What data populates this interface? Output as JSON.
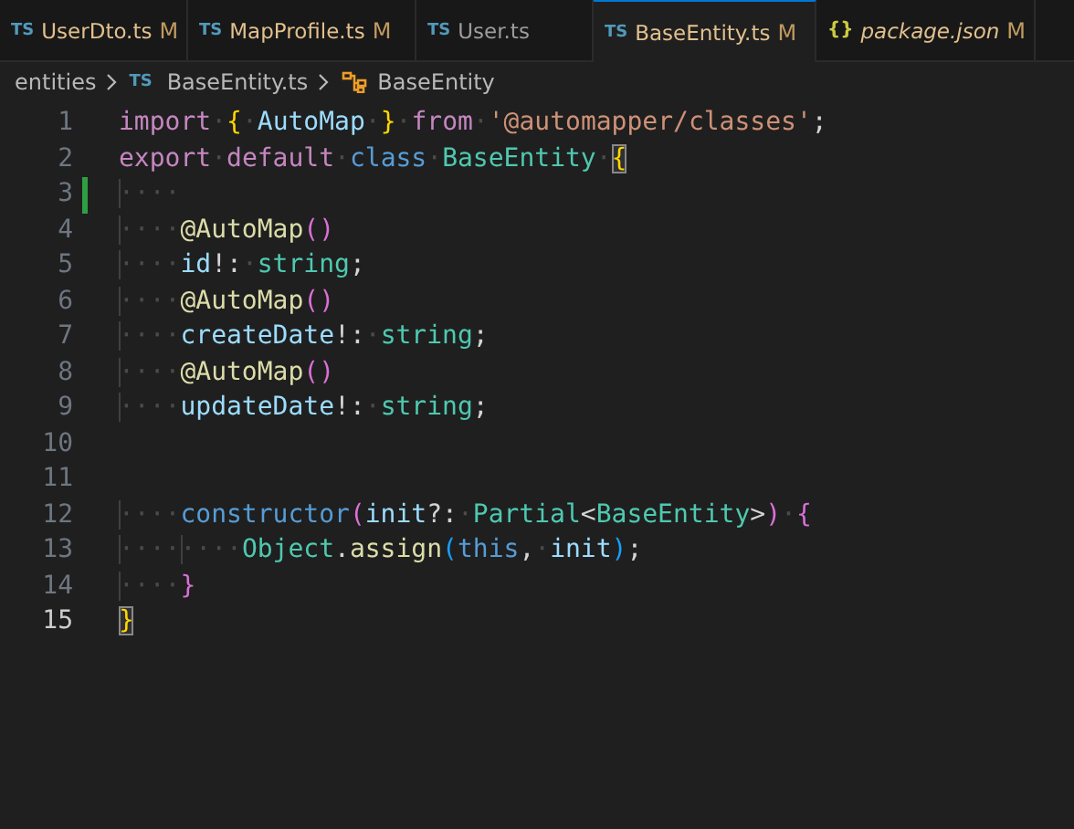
{
  "tabs": [
    {
      "kind": "ts",
      "icon_text": "TS",
      "label": "UserDto.ts",
      "status": "M",
      "selected": false,
      "preview": false
    },
    {
      "kind": "ts",
      "icon_text": "TS",
      "label": "MapProfile.ts",
      "status": "M",
      "selected": false,
      "preview": false
    },
    {
      "kind": "ts",
      "icon_text": "TS",
      "label": "User.ts",
      "selected": false,
      "preview": false
    },
    {
      "kind": "ts",
      "icon_text": "TS",
      "label": "BaseEntity.ts",
      "status": "M",
      "selected": true,
      "preview": false
    },
    {
      "kind": "json",
      "icon_text": "{}",
      "label": "package.json",
      "status": "M",
      "selected": false,
      "preview": true
    }
  ],
  "breadcrumb": [
    {
      "kind": "folder",
      "label": "entities"
    },
    {
      "kind": "file",
      "icon_text": "TS",
      "label": "BaseEntity.ts"
    },
    {
      "kind": "class",
      "label": "BaseEntity"
    }
  ],
  "lines": [
    {
      "number": "1",
      "tokens": [
        {
          "kind": "kw",
          "text": "import"
        },
        {
          "kind": "ws",
          "text": "·"
        },
        {
          "kind": "brace",
          "text": "{"
        },
        {
          "kind": "ws",
          "text": "·"
        },
        {
          "kind": "ident",
          "text": "AutoMap"
        },
        {
          "kind": "ws",
          "text": "·"
        },
        {
          "kind": "brace",
          "text": "}"
        },
        {
          "kind": "ws",
          "text": "·"
        },
        {
          "kind": "kw",
          "text": "from"
        },
        {
          "kind": "ws",
          "text": "·"
        },
        {
          "kind": "str",
          "text": "'@automapper/classes'"
        },
        {
          "kind": "plain",
          "text": ";"
        }
      ]
    },
    {
      "number": "2",
      "tokens": [
        {
          "kind": "kw",
          "text": "export"
        },
        {
          "kind": "ws",
          "text": "·"
        },
        {
          "kind": "kw",
          "text": "default"
        },
        {
          "kind": "ws",
          "text": "·"
        },
        {
          "kind": "storage",
          "text": "class"
        },
        {
          "kind": "ws",
          "text": "·"
        },
        {
          "kind": "type",
          "text": "BaseEntity"
        },
        {
          "kind": "ws",
          "text": "·"
        },
        {
          "kind": "match",
          "text": "{"
        }
      ]
    },
    {
      "number": "3",
      "modified": true,
      "tokens": [
        {
          "kind": "indent",
          "text": "····"
        }
      ]
    },
    {
      "number": "4",
      "tokens": [
        {
          "kind": "indent",
          "text": "····"
        },
        {
          "kind": "func",
          "text": "@AutoMap"
        },
        {
          "kind": "paren",
          "text": "()"
        }
      ]
    },
    {
      "number": "5",
      "tokens": [
        {
          "kind": "indent",
          "text": "····"
        },
        {
          "kind": "ident",
          "text": "id"
        },
        {
          "kind": "plain",
          "text": "!:"
        },
        {
          "kind": "ws",
          "text": "·"
        },
        {
          "kind": "type",
          "text": "string"
        },
        {
          "kind": "plain",
          "text": ";"
        }
      ]
    },
    {
      "number": "6",
      "tokens": [
        {
          "kind": "indent",
          "text": "····"
        },
        {
          "kind": "func",
          "text": "@AutoMap"
        },
        {
          "kind": "paren",
          "text": "()"
        }
      ]
    },
    {
      "number": "7",
      "tokens": [
        {
          "kind": "indent",
          "text": "····"
        },
        {
          "kind": "ident",
          "text": "createDate"
        },
        {
          "kind": "plain",
          "text": "!:"
        },
        {
          "kind": "ws",
          "text": "·"
        },
        {
          "kind": "type",
          "text": "string"
        },
        {
          "kind": "plain",
          "text": ";"
        }
      ]
    },
    {
      "number": "8",
      "tokens": [
        {
          "kind": "indent",
          "text": "····"
        },
        {
          "kind": "func",
          "text": "@AutoMap"
        },
        {
          "kind": "paren",
          "text": "()"
        }
      ]
    },
    {
      "number": "9",
      "tokens": [
        {
          "kind": "indent",
          "text": "····"
        },
        {
          "kind": "ident",
          "text": "updateDate"
        },
        {
          "kind": "plain",
          "text": "!:"
        },
        {
          "kind": "ws",
          "text": "·"
        },
        {
          "kind": "type",
          "text": "string"
        },
        {
          "kind": "plain",
          "text": ";"
        }
      ]
    },
    {
      "number": "10"
    },
    {
      "number": "11"
    },
    {
      "number": "12",
      "tokens": [
        {
          "kind": "indent",
          "text": "····"
        },
        {
          "kind": "storage",
          "text": "constructor"
        },
        {
          "kind": "paren",
          "text": "("
        },
        {
          "kind": "ident",
          "text": "init"
        },
        {
          "kind": "plain",
          "text": "?:"
        },
        {
          "kind": "ws",
          "text": "·"
        },
        {
          "kind": "type",
          "text": "Partial"
        },
        {
          "kind": "plain",
          "text": "<"
        },
        {
          "kind": "type",
          "text": "BaseEntity"
        },
        {
          "kind": "plain",
          "text": ">"
        },
        {
          "kind": "paren",
          "text": ")"
        },
        {
          "kind": "ws",
          "text": "·"
        },
        {
          "kind": "paren",
          "text": "{"
        }
      ]
    },
    {
      "number": "13",
      "tokens": [
        {
          "kind": "indent",
          "text": "····"
        },
        {
          "kind": "indent",
          "text": "····"
        },
        {
          "kind": "type",
          "text": "Object"
        },
        {
          "kind": "plain",
          "text": "."
        },
        {
          "kind": "func",
          "text": "assign"
        },
        {
          "kind": "paren3",
          "text": "("
        },
        {
          "kind": "storage",
          "text": "this"
        },
        {
          "kind": "plain",
          "text": ","
        },
        {
          "kind": "ws",
          "text": "·"
        },
        {
          "kind": "ident",
          "text": "init"
        },
        {
          "kind": "paren3",
          "text": ")"
        },
        {
          "kind": "plain",
          "text": ";"
        }
      ]
    },
    {
      "number": "14",
      "tokens": [
        {
          "kind": "indent",
          "text": "····"
        },
        {
          "kind": "paren",
          "text": "}"
        }
      ]
    },
    {
      "number": "15",
      "current": true,
      "tokens": [
        {
          "kind": "match",
          "text": "}"
        }
      ]
    }
  ]
}
